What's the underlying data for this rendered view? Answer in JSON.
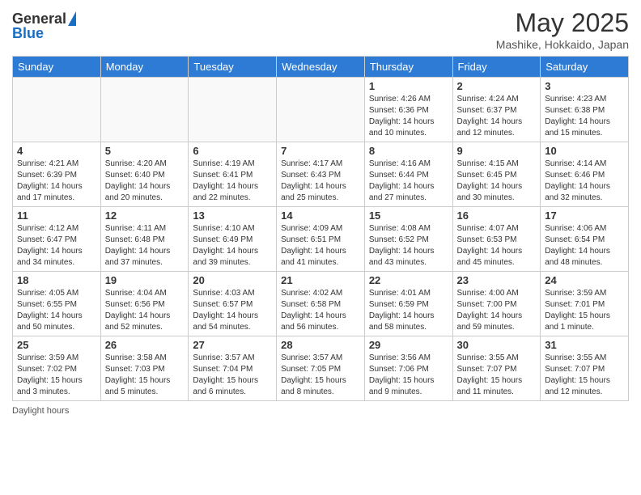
{
  "header": {
    "logo_general": "General",
    "logo_blue": "Blue",
    "month_title": "May 2025",
    "location": "Mashike, Hokkaido, Japan"
  },
  "weekdays": [
    "Sunday",
    "Monday",
    "Tuesday",
    "Wednesday",
    "Thursday",
    "Friday",
    "Saturday"
  ],
  "weeks": [
    [
      {
        "day": "",
        "info": ""
      },
      {
        "day": "",
        "info": ""
      },
      {
        "day": "",
        "info": ""
      },
      {
        "day": "",
        "info": ""
      },
      {
        "day": "1",
        "info": "Sunrise: 4:26 AM\nSunset: 6:36 PM\nDaylight: 14 hours\nand 10 minutes."
      },
      {
        "day": "2",
        "info": "Sunrise: 4:24 AM\nSunset: 6:37 PM\nDaylight: 14 hours\nand 12 minutes."
      },
      {
        "day": "3",
        "info": "Sunrise: 4:23 AM\nSunset: 6:38 PM\nDaylight: 14 hours\nand 15 minutes."
      }
    ],
    [
      {
        "day": "4",
        "info": "Sunrise: 4:21 AM\nSunset: 6:39 PM\nDaylight: 14 hours\nand 17 minutes."
      },
      {
        "day": "5",
        "info": "Sunrise: 4:20 AM\nSunset: 6:40 PM\nDaylight: 14 hours\nand 20 minutes."
      },
      {
        "day": "6",
        "info": "Sunrise: 4:19 AM\nSunset: 6:41 PM\nDaylight: 14 hours\nand 22 minutes."
      },
      {
        "day": "7",
        "info": "Sunrise: 4:17 AM\nSunset: 6:43 PM\nDaylight: 14 hours\nand 25 minutes."
      },
      {
        "day": "8",
        "info": "Sunrise: 4:16 AM\nSunset: 6:44 PM\nDaylight: 14 hours\nand 27 minutes."
      },
      {
        "day": "9",
        "info": "Sunrise: 4:15 AM\nSunset: 6:45 PM\nDaylight: 14 hours\nand 30 minutes."
      },
      {
        "day": "10",
        "info": "Sunrise: 4:14 AM\nSunset: 6:46 PM\nDaylight: 14 hours\nand 32 minutes."
      }
    ],
    [
      {
        "day": "11",
        "info": "Sunrise: 4:12 AM\nSunset: 6:47 PM\nDaylight: 14 hours\nand 34 minutes."
      },
      {
        "day": "12",
        "info": "Sunrise: 4:11 AM\nSunset: 6:48 PM\nDaylight: 14 hours\nand 37 minutes."
      },
      {
        "day": "13",
        "info": "Sunrise: 4:10 AM\nSunset: 6:49 PM\nDaylight: 14 hours\nand 39 minutes."
      },
      {
        "day": "14",
        "info": "Sunrise: 4:09 AM\nSunset: 6:51 PM\nDaylight: 14 hours\nand 41 minutes."
      },
      {
        "day": "15",
        "info": "Sunrise: 4:08 AM\nSunset: 6:52 PM\nDaylight: 14 hours\nand 43 minutes."
      },
      {
        "day": "16",
        "info": "Sunrise: 4:07 AM\nSunset: 6:53 PM\nDaylight: 14 hours\nand 45 minutes."
      },
      {
        "day": "17",
        "info": "Sunrise: 4:06 AM\nSunset: 6:54 PM\nDaylight: 14 hours\nand 48 minutes."
      }
    ],
    [
      {
        "day": "18",
        "info": "Sunrise: 4:05 AM\nSunset: 6:55 PM\nDaylight: 14 hours\nand 50 minutes."
      },
      {
        "day": "19",
        "info": "Sunrise: 4:04 AM\nSunset: 6:56 PM\nDaylight: 14 hours\nand 52 minutes."
      },
      {
        "day": "20",
        "info": "Sunrise: 4:03 AM\nSunset: 6:57 PM\nDaylight: 14 hours\nand 54 minutes."
      },
      {
        "day": "21",
        "info": "Sunrise: 4:02 AM\nSunset: 6:58 PM\nDaylight: 14 hours\nand 56 minutes."
      },
      {
        "day": "22",
        "info": "Sunrise: 4:01 AM\nSunset: 6:59 PM\nDaylight: 14 hours\nand 58 minutes."
      },
      {
        "day": "23",
        "info": "Sunrise: 4:00 AM\nSunset: 7:00 PM\nDaylight: 14 hours\nand 59 minutes."
      },
      {
        "day": "24",
        "info": "Sunrise: 3:59 AM\nSunset: 7:01 PM\nDaylight: 15 hours\nand 1 minute."
      }
    ],
    [
      {
        "day": "25",
        "info": "Sunrise: 3:59 AM\nSunset: 7:02 PM\nDaylight: 15 hours\nand 3 minutes."
      },
      {
        "day": "26",
        "info": "Sunrise: 3:58 AM\nSunset: 7:03 PM\nDaylight: 15 hours\nand 5 minutes."
      },
      {
        "day": "27",
        "info": "Sunrise: 3:57 AM\nSunset: 7:04 PM\nDaylight: 15 hours\nand 6 minutes."
      },
      {
        "day": "28",
        "info": "Sunrise: 3:57 AM\nSunset: 7:05 PM\nDaylight: 15 hours\nand 8 minutes."
      },
      {
        "day": "29",
        "info": "Sunrise: 3:56 AM\nSunset: 7:06 PM\nDaylight: 15 hours\nand 9 minutes."
      },
      {
        "day": "30",
        "info": "Sunrise: 3:55 AM\nSunset: 7:07 PM\nDaylight: 15 hours\nand 11 minutes."
      },
      {
        "day": "31",
        "info": "Sunrise: 3:55 AM\nSunset: 7:07 PM\nDaylight: 15 hours\nand 12 minutes."
      }
    ]
  ],
  "footer": {
    "daylight_label": "Daylight hours"
  }
}
